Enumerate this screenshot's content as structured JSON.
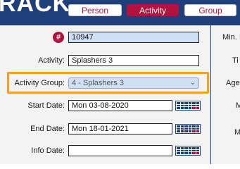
{
  "header": {
    "logo": "RACK",
    "tabs": [
      {
        "label": "Person"
      },
      {
        "label": "Activity",
        "active": true
      },
      {
        "label": "Group"
      }
    ]
  },
  "form": {
    "id": {
      "icon": "hash-icon",
      "value": "10947"
    },
    "activity": {
      "label": "Activity:",
      "value": "Splashers 3"
    },
    "activity_group": {
      "label": "Activity Group:",
      "value": "4 - Splashers 3"
    },
    "start_date": {
      "label": "Start Date:",
      "value": "Mon 03-08-2020"
    },
    "end_date": {
      "label": "End Date:",
      "value": "Mon 18-01-2021"
    },
    "info_date": {
      "label": "Info Date:",
      "value": ""
    }
  },
  "right_panel": {
    "labels": [
      "Min. I",
      "Ti",
      "Age",
      "M",
      "M"
    ]
  },
  "colors": {
    "brand_navy": "#1e3f7a",
    "accent_red": "#b3123f",
    "highlight_orange": "#f5a01e",
    "readonly_blue": "#cfe0f5"
  }
}
